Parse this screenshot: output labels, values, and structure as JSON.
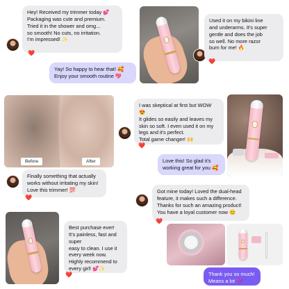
{
  "reviews": [
    {
      "text": "Hey! Received my trimmer today 💕\nPackaging was cute and premium.\nTried it in the shower and omg...\nso smooth! No cuts, no irritation.\nI'm impressed! ✨",
      "reaction": "❤️"
    },
    {
      "text": "Used it on my bikini line\nand underarms. It's super\ngentle and does the job\nso well. No more razor\nburn for me! 🔥",
      "reaction": "❤️"
    },
    {
      "text": "I was skeptical at first but WOW 😍\nIt glides so easily and leaves my\nskin so soft. I even used it on my\nlegs and it's perfect.\nTotal game changer! 🙌",
      "reaction": "❤️"
    },
    {
      "text": "Finally something that actually\nworks without irritating my skin!\nLove this trimmer! 💯",
      "reaction": "❤️"
    },
    {
      "text": "Got mine today! Loved the dual-head\nfeature, it makes such a difference.\nThanks for such an amazing product!\nYou have a loyal customer now 😊",
      "reaction": "❤️"
    },
    {
      "text": "Best purchase ever!\nIt's painless, fast and super\neasy to clean. I use it\nevery week now.\nHighly recommend to\nevery girl! 💕✨",
      "reaction": "❤️"
    }
  ],
  "replies": [
    {
      "text": "Yay! So happy to hear that! 🥰\nEnjoy your smooth routine 💖"
    },
    {
      "text": "Love this! So glad it's\nworking great for you 🥰"
    },
    {
      "text": "Thank you so much!\nMeans a lot 💜"
    }
  ],
  "photo_labels": {
    "before": "Before",
    "after": "After"
  },
  "colors": {
    "bubble": "#ececef",
    "reply": "#d9d7fb",
    "reply_dark": "#7a5cf0",
    "heart": "#ef2d4a",
    "trimmer_pink": "#f4b6c4"
  }
}
